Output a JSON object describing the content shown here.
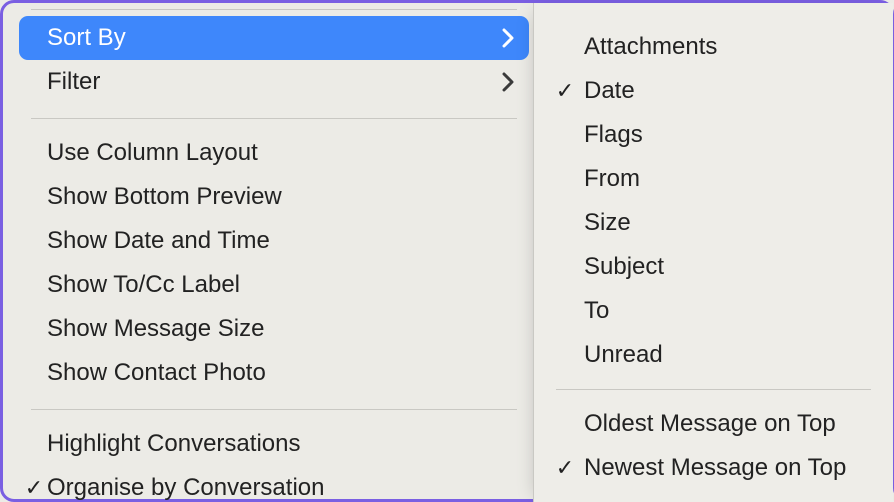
{
  "menu": {
    "sort_by": "Sort By",
    "filter": "Filter",
    "use_column_layout": "Use Column Layout",
    "show_bottom_preview": "Show Bottom Preview",
    "show_date_time": "Show Date and Time",
    "show_tocc_label": "Show To/Cc Label",
    "show_message_size": "Show Message Size",
    "show_contact_photo": "Show Contact Photo",
    "highlight_conversations": "Highlight Conversations",
    "organise_by_conversation": "Organise by Conversation"
  },
  "check": "✓",
  "submenu": {
    "attachments": "Attachments",
    "date": "Date",
    "flags": "Flags",
    "from": "From",
    "size": "Size",
    "subject": "Subject",
    "to": "To",
    "unread": "Unread",
    "oldest_on_top": "Oldest Message on Top",
    "newest_on_top": "Newest Message on Top"
  }
}
